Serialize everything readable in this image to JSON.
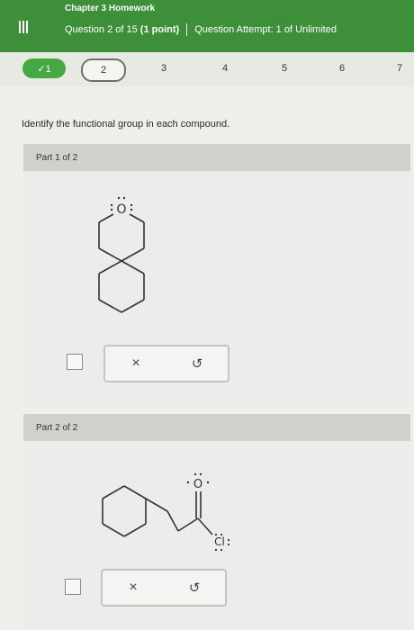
{
  "header": {
    "chapter_title": "Chapter 3 Homework",
    "question_position": "Question 2 of 15",
    "points": "(1 point)",
    "attempt": "Question Attempt: 1 of Unlimited"
  },
  "question_nav": {
    "items": [
      {
        "label": "✓1",
        "state": "done"
      },
      {
        "label": "2",
        "state": "current"
      },
      {
        "label": "3",
        "state": "pending"
      },
      {
        "label": "4",
        "state": "pending"
      },
      {
        "label": "5",
        "state": "pending"
      },
      {
        "label": "6",
        "state": "pending"
      },
      {
        "label": "7",
        "state": "pending"
      }
    ]
  },
  "instruction": "Identify the functional group in each compound.",
  "parts": [
    {
      "header": "Part 1 of 2",
      "atom_label": "O",
      "toolbar": {
        "clear": "×",
        "undo": "↺"
      }
    },
    {
      "header": "Part 2 of 2",
      "atom_label_1": "O",
      "atom_label_2": "Cl",
      "toolbar": {
        "clear": "×",
        "undo": "↺"
      }
    }
  ],
  "colors": {
    "header_green": "#3d8f3a",
    "done_green": "#46a843",
    "part_header_gray": "#cfd1cd"
  }
}
